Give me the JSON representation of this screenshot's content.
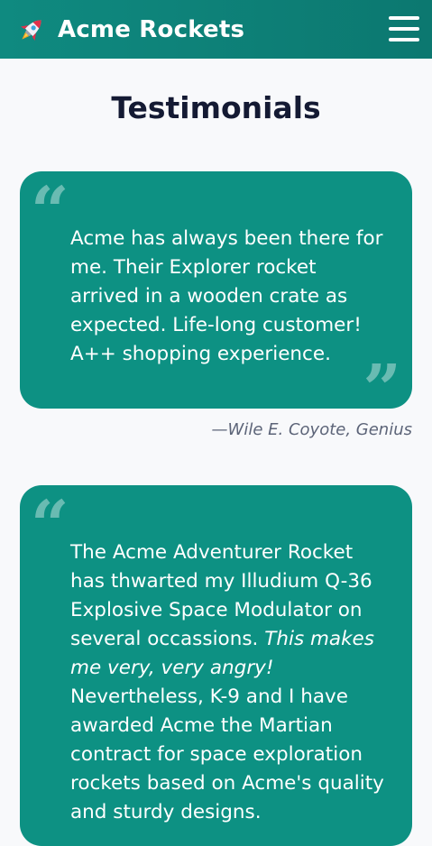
{
  "header": {
    "brand_name": "Acme Rockets",
    "logo_icon": "rocket-icon",
    "menu_icon": "hamburger-menu-icon"
  },
  "main": {
    "title": "Testimonials",
    "testimonials": [
      {
        "quote": "Acme has always been there for me. Their Explorer rocket arrived in a wooden crate as expected. Life-long customer! A++ shopping experience.",
        "attribution": "—Wile E. Coyote, Genius"
      },
      {
        "quote_part1": "The Acme Adventurer Rocket has thwarted my Illudium Q-36 Explosive Space Modulator on several occassions.",
        "quote_emphasis": "This makes me very, very angry!",
        "quote_part2": "Nevertheless, K-9 and I have awarded Acme the Martian contract for space exploration rockets based on Acme's quality and sturdy designs."
      }
    ]
  },
  "colors": {
    "header_bg": "#0f8a80",
    "card_bg": "#0d9183",
    "page_bg": "#f8f9fb",
    "title_text": "#141a33",
    "attribution_text": "#5c6478"
  }
}
